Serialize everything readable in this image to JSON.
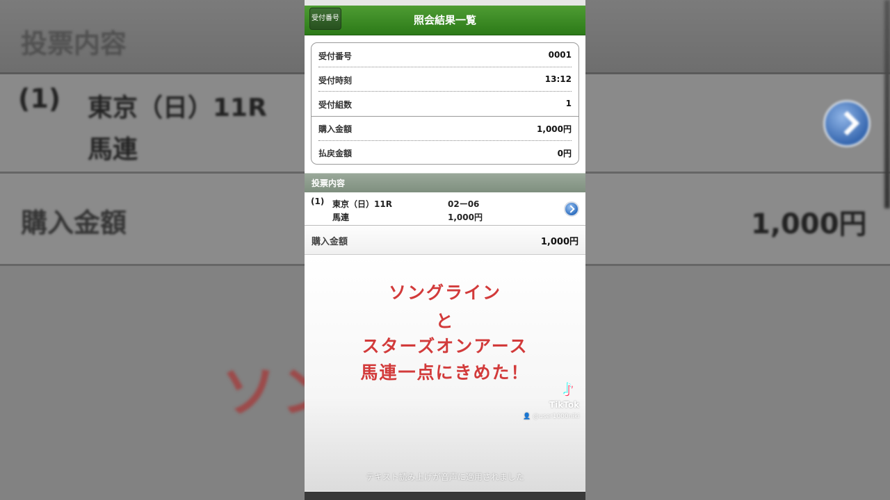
{
  "background": {
    "header_title": "投票内容",
    "row1": {
      "num": "(1)",
      "race": "東京（日）11R",
      "type": "馬連"
    },
    "row2": {
      "label": "購入金額",
      "value": "1,000円"
    },
    "big_text": "ソン     ン"
  },
  "navbar": {
    "back_label": "受付番号",
    "title": "照会結果一覧"
  },
  "info": {
    "rows": [
      {
        "label": "受付番号",
        "value": "0001"
      },
      {
        "label": "受付時刻",
        "value": "13:12"
      },
      {
        "label": "受付組数",
        "value": "1"
      },
      {
        "label": "購入金額",
        "value": "1,000円"
      },
      {
        "label": "払戻金額",
        "value": "0円"
      }
    ]
  },
  "section": {
    "title": "投票内容"
  },
  "bet": {
    "num": "(1)",
    "race": "東京（日）11R",
    "type": "馬連",
    "combo": "02ー06",
    "amount": "1,000円"
  },
  "total": {
    "label": "購入金額",
    "value": "1,000円"
  },
  "caption": {
    "lines": [
      "ソングライン",
      "と",
      "スターズオンアース",
      "馬連一点にきめた！"
    ],
    "color": "#d23a3a"
  },
  "tiktok": {
    "logo_icon": "tiktok-note-icon",
    "brand": "TikTok",
    "user": "@user1000niki"
  },
  "tts_notice": "テキスト読み上げが音声に適用されました",
  "colors": {
    "nav_green": "#2c7a18",
    "section_gray": "#8a998a",
    "arrow_blue": "#2f6fc0"
  }
}
